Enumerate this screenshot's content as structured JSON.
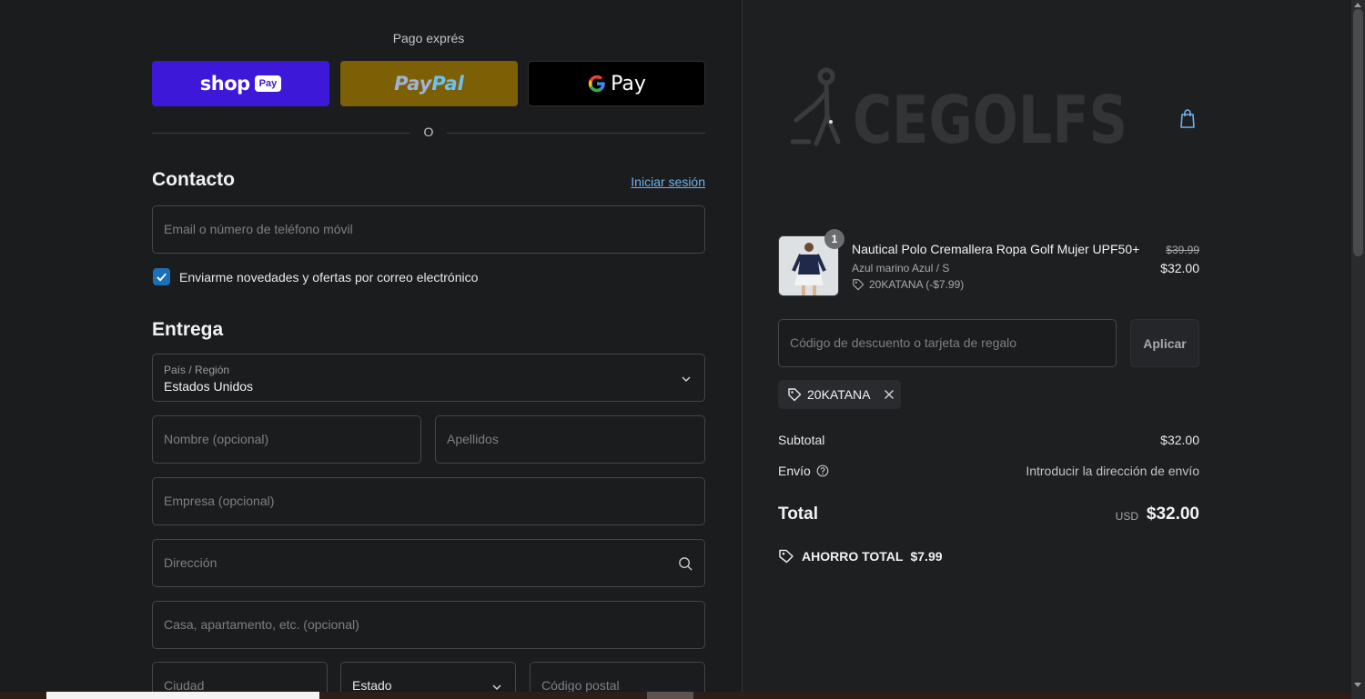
{
  "express": {
    "title": "Pago exprés",
    "shop_pay": {
      "word": "shop",
      "badge": "Pay"
    },
    "paypal": {
      "part1": "Pay",
      "part2": "Pal"
    },
    "gpay": {
      "g": "G",
      "word": "Pay"
    },
    "divider": "O"
  },
  "contact": {
    "title": "Contacto",
    "login_link": "Iniciar sesión",
    "email_placeholder": "Email o número de teléfono móvil",
    "newsletter_label": "Enviarme novedades y ofertas por correo electrónico",
    "newsletter_checked": true
  },
  "delivery": {
    "title": "Entrega",
    "country_label": "País / Región",
    "country_value": "Estados Unidos",
    "first_name_placeholder": "Nombre (opcional)",
    "last_name_placeholder": "Apellidos",
    "company_placeholder": "Empresa (opcional)",
    "address_placeholder": "Dirección",
    "apartment_placeholder": "Casa, apartamento, etc. (opcional)",
    "city_placeholder": "Ciudad",
    "state_value": "Estado",
    "zip_placeholder": "Código postal"
  },
  "summary": {
    "logo_text": "CEGOLFS",
    "product": {
      "quantity": "1",
      "name": "Nautical Polo Cremallera Ropa Golf Mujer UPF50+",
      "variant": "Azul marino Azul / S",
      "discount": "20KATANA (-$7.99)",
      "old_price": "$39.99",
      "price": "$32.00"
    },
    "discount_placeholder": "Código de descuento o tarjeta de regalo",
    "apply_label": "Aplicar",
    "applied_code": "20KATANA",
    "subtotal_label": "Subtotal",
    "subtotal_value": "$32.00",
    "shipping_label": "Envío",
    "shipping_value": "Introducir la dirección de envío",
    "total_label": "Total",
    "total_currency": "USD",
    "total_value": "$32.00",
    "savings_label": "AHORRO TOTAL",
    "savings_value": "$7.99"
  },
  "colors": {
    "shop_pay": "#3d18d8",
    "paypal": "#7d5f06",
    "link": "#6cb2f0",
    "checkbox": "#1a6fb8"
  }
}
